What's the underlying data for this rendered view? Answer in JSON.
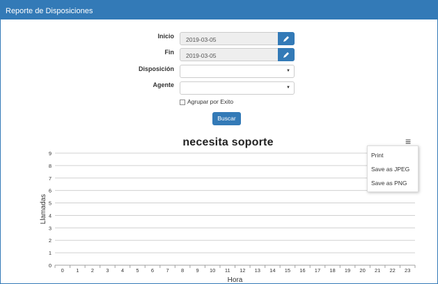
{
  "panel": {
    "title": "Reporte de Disposiciones"
  },
  "form": {
    "inicio_label": "Inicio",
    "inicio_value": "2019-03-05",
    "fin_label": "Fin",
    "fin_value": "2019-03-05",
    "disposicion_label": "Disposición",
    "disposicion_value": "",
    "agente_label": "Agente",
    "agente_value": "",
    "group_label": "Agrupar por Exito",
    "search_label": "Buscar"
  },
  "menu": {
    "print": "Print",
    "jpeg": "Save as JPEG",
    "png": "Save as PNG"
  },
  "chart_data": {
    "type": "line",
    "title": "necesita soporte",
    "xlabel": "Hora",
    "ylabel": "Llamadas",
    "x": [
      0,
      1,
      2,
      3,
      4,
      5,
      6,
      7,
      8,
      9,
      10,
      11,
      12,
      13,
      14,
      15,
      16,
      17,
      18,
      19,
      20,
      21,
      22,
      23
    ],
    "ylim": [
      0,
      9
    ],
    "y_ticks": [
      0,
      1,
      2,
      3,
      4,
      5,
      6,
      7,
      8,
      9
    ],
    "series": [],
    "grid": true,
    "legend": "none"
  }
}
